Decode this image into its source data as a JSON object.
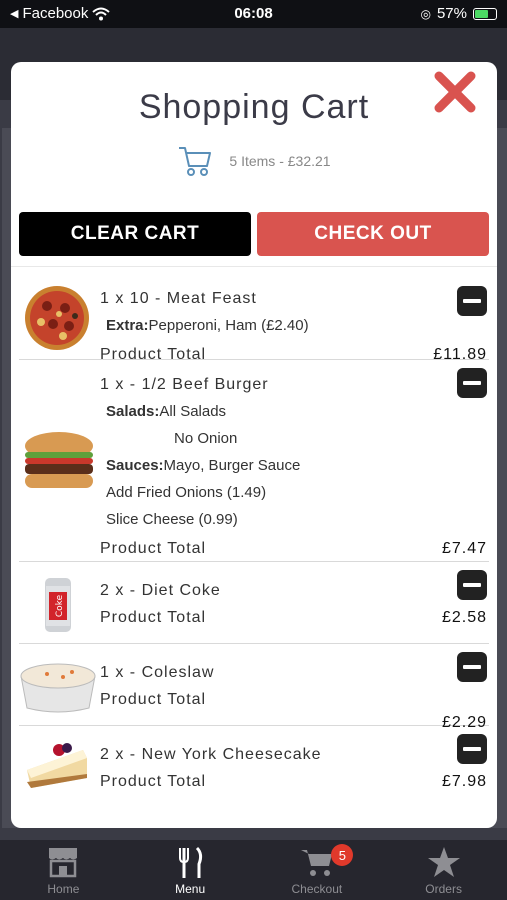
{
  "status_bar": {
    "back_app": "Facebook",
    "time": "06:08",
    "battery": "57%"
  },
  "modal": {
    "title": "Shopping Cart",
    "summary": "5 Items - £32.21",
    "clear_label": "CLEAR CART",
    "checkout_label": "CHECK OUT"
  },
  "items": [
    {
      "name": "1 x 10 - Meat Feast",
      "extra_label": "Extra:",
      "extra_value": "Pepperoni, Ham (£2.40)",
      "total_label": "Product Total",
      "total": "£11.89"
    },
    {
      "name": "1 x - 1/2 Beef Burger",
      "salads_label": "Salads:",
      "salads_value": "All Salads",
      "no_onion": "No Onion",
      "sauces_label": "Sauces:",
      "sauces_value": "Mayo, Burger Sauce",
      "add1": "Add Fried Onions (1.49)",
      "add2": "Slice Cheese (0.99)",
      "total_label": "Product Total",
      "total": "£7.47"
    },
    {
      "name": "2 x - Diet Coke",
      "total_label": "Product Total",
      "total": "£2.58"
    },
    {
      "name": "1 x - Coleslaw",
      "total_label": "Product Total",
      "total": "£2.29"
    },
    {
      "name": "2 x - New York Cheesecake",
      "total_label": "Product Total",
      "total": "£7.98"
    }
  ],
  "nav": {
    "home": "Home",
    "menu": "Menu",
    "checkout": "Checkout",
    "checkout_badge": "5",
    "orders": "Orders"
  },
  "colors": {
    "checkout_red": "#d9544f",
    "close_red": "#d9534f",
    "badge_red": "#e0392b"
  }
}
